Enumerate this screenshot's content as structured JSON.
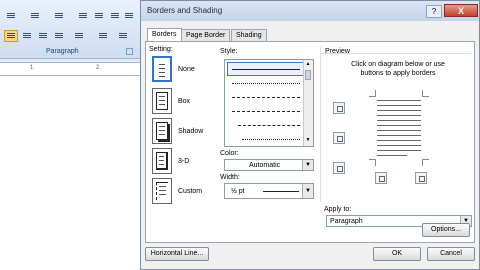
{
  "word": {
    "group_label": "Paragraph",
    "ruler_marks": [
      "1",
      "2"
    ]
  },
  "dialog": {
    "title": "Borders and Shading",
    "help_glyph": "?",
    "close_glyph": "X",
    "tabs": [
      "Borders",
      "Page Border",
      "Shading"
    ],
    "setting": {
      "label": "Setting:",
      "options": [
        "None",
        "Box",
        "Shadow",
        "3-D",
        "Custom"
      ],
      "selected": "None"
    },
    "style": {
      "label": "Style:",
      "items": [
        "solid",
        "dotted",
        "dashed-small",
        "dashed-large",
        "dash-dot",
        "dash-dot-dot"
      ]
    },
    "color": {
      "label": "Color:",
      "value": "Automatic"
    },
    "width": {
      "label": "Width:",
      "value": "½ pt"
    },
    "preview": {
      "label": "Preview",
      "instructions": "Click on diagram below or use buttons to apply borders"
    },
    "apply_to": {
      "label": "Apply to:",
      "value": "Paragraph"
    },
    "buttons": {
      "options": "Options...",
      "horizontal_line": "Horizontal Line...",
      "ok": "OK",
      "cancel": "Cancel"
    }
  }
}
